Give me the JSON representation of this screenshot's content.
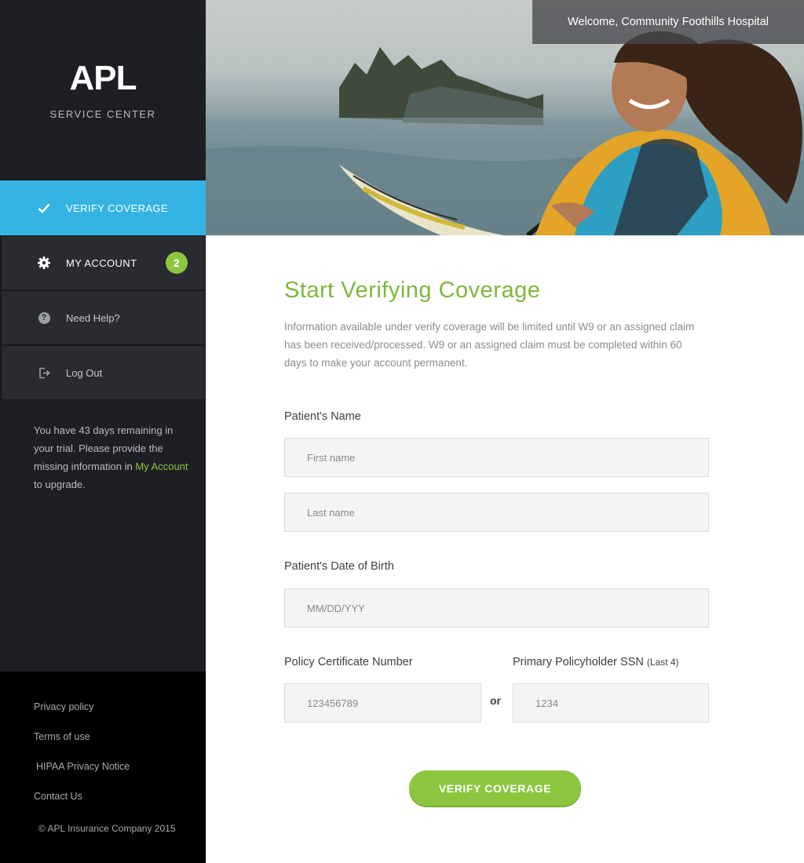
{
  "brand": {
    "logo_text": "APL",
    "subtitle": "SERVICE CENTER"
  },
  "nav": {
    "items": [
      {
        "label": "VERIFY COVERAGE",
        "icon": "check-icon",
        "active": true
      },
      {
        "label": "MY ACCOUNT",
        "icon": "gear-icon",
        "badge": "2"
      },
      {
        "label": "Need Help?",
        "icon": "help-icon"
      },
      {
        "label": "Log Out",
        "icon": "logout-icon"
      }
    ]
  },
  "trial": {
    "text_before": "You have 43 days remaining in your trial. Please provide the missing information in ",
    "link": "My Account",
    "text_after": " to upgrade."
  },
  "footer": {
    "links": [
      "Privacy policy",
      "Terms of use",
      "HIPAA Privacy Notice",
      "Contact Us"
    ],
    "copyright": "© APL Insurance Company 2015"
  },
  "header": {
    "welcome": "Welcome, Community Foothills Hospital"
  },
  "main": {
    "title": "Start Verifying Coverage",
    "intro": "Information available under verify coverage will be limited until W9 or an assigned claim has been received/processed. W9 or an assigned claim must be completed within 60 days to make your account permanent.",
    "patient_name_label": "Patient's Name",
    "first_name_placeholder": "First name",
    "last_name_placeholder": "Last name",
    "dob_label": "Patient's Date of Birth",
    "dob_placeholder": "MM/DD/YYY",
    "policy_label": "Policy Certificate Number",
    "policy_placeholder": "123456789",
    "or_text": "or",
    "ssn_label": "Primary Policyholder SSN",
    "ssn_label_suffix": "(Last 4)",
    "ssn_placeholder": "1234",
    "submit_label": "VERIFY COVERAGE"
  },
  "colors": {
    "sidebar_bg": "#1e1f24",
    "active_nav": "#35b4e3",
    "accent_green": "#8cc63f",
    "heading_green": "#7fb73a"
  }
}
